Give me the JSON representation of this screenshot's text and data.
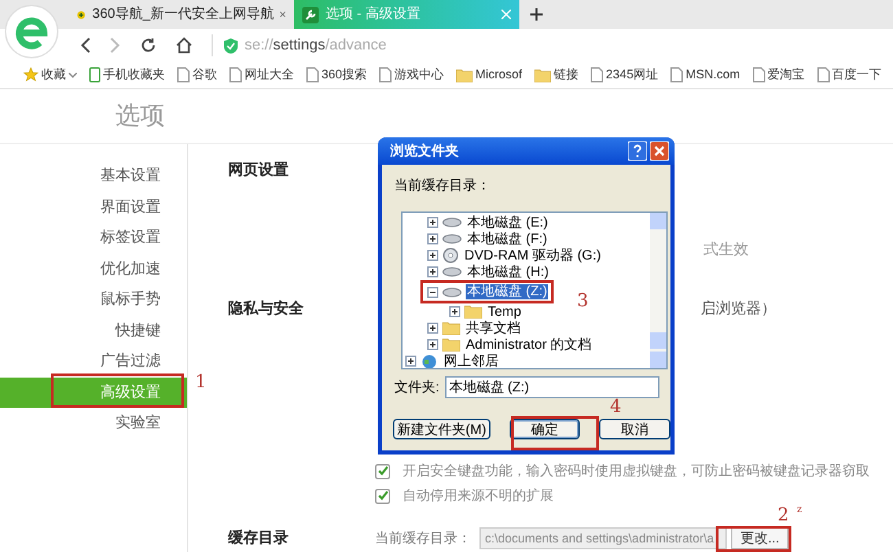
{
  "browser": {
    "tabs": [
      {
        "title": "360导航_新一代安全上网导航",
        "selected": false
      },
      {
        "title": "选项 - 高级设置",
        "selected": true
      }
    ],
    "address": {
      "scheme": "se://",
      "host": "settings",
      "path": "/advance"
    },
    "bookmarks": [
      {
        "label": "收藏",
        "kind": "star"
      },
      {
        "label": "手机收藏夹",
        "kind": "phone"
      },
      {
        "label": "谷歌",
        "kind": "page"
      },
      {
        "label": "网址大全",
        "kind": "page"
      },
      {
        "label": "360搜索",
        "kind": "page"
      },
      {
        "label": "游戏中心",
        "kind": "page"
      },
      {
        "label": "Microsof",
        "kind": "folder"
      },
      {
        "label": "链接",
        "kind": "folder"
      },
      {
        "label": "2345网址",
        "kind": "page"
      },
      {
        "label": "MSN.com",
        "kind": "page"
      },
      {
        "label": "爱淘宝",
        "kind": "page"
      },
      {
        "label": "百度一下",
        "kind": "page"
      }
    ]
  },
  "page": {
    "title": "选项",
    "sidebar": {
      "items": [
        {
          "label": "基本设置",
          "selected": false
        },
        {
          "label": "界面设置",
          "selected": false
        },
        {
          "label": "标签设置",
          "selected": false
        },
        {
          "label": "优化加速",
          "selected": false
        },
        {
          "label": "鼠标手势",
          "selected": false
        },
        {
          "label": "快捷键",
          "selected": false
        },
        {
          "label": "广告过滤",
          "selected": false
        },
        {
          "label": "高级设置",
          "selected": true
        },
        {
          "label": "实验室",
          "selected": false
        }
      ]
    },
    "sections": [
      {
        "heading": "网页设置",
        "fragment": "式生效"
      },
      {
        "heading": "隐私与安全",
        "fragment": "启浏览器）",
        "checkboxes": [
          {
            "label": "开启安全键盘功能，输入密码时使用虚拟键盘，可防止密码被键盘记录器窃取",
            "checked": true
          },
          {
            "label": "自动停用来源不明的扩展",
            "checked": true
          }
        ]
      },
      {
        "heading": "缓存目录",
        "field_label": "当前缓存目录：",
        "field_value": "c:\\documents and settings\\administrator\\a",
        "button": "更改..."
      }
    ]
  },
  "dialog": {
    "title": "浏览文件夹",
    "prompt": "当前缓存目录：",
    "tree": {
      "items": [
        {
          "label": "本地磁盘 (E:)",
          "kind": "drive",
          "expanded": false,
          "selected": false
        },
        {
          "label": "本地磁盘 (F:)",
          "kind": "drive",
          "expanded": false,
          "selected": false
        },
        {
          "label": "DVD-RAM 驱动器 (G:)",
          "kind": "dvd",
          "expanded": false,
          "selected": false
        },
        {
          "label": "本地磁盘 (H:)",
          "kind": "drive",
          "expanded": false,
          "selected": false
        },
        {
          "label": "本地磁盘 (Z:)",
          "kind": "drive",
          "expanded": true,
          "selected": true,
          "children": [
            {
              "label": "Temp",
              "kind": "folder",
              "expanded": false,
              "selected": false
            }
          ]
        },
        {
          "label": "共享文档",
          "kind": "folder",
          "expanded": false,
          "selected": false
        },
        {
          "label": "Administrator 的文档",
          "kind": "folder",
          "expanded": false,
          "selected": false
        }
      ],
      "after": [
        {
          "label": "网上邻居",
          "kind": "network",
          "expanded": false,
          "selected": false
        }
      ]
    },
    "folder_label": "文件夹:",
    "folder_value": "本地磁盘 (Z:)",
    "buttons": [
      {
        "label": "新建文件夹(M)",
        "kind": "new"
      },
      {
        "label": "确定",
        "kind": "ok"
      },
      {
        "label": "取消",
        "kind": "cancel"
      }
    ]
  },
  "annotations": [
    {
      "label": "1",
      "kind": "step"
    },
    {
      "label": "2",
      "kind": "step"
    },
    {
      "label": "z",
      "kind": "small"
    },
    {
      "label": "3",
      "kind": "step"
    },
    {
      "label": "4",
      "kind": "step"
    }
  ]
}
